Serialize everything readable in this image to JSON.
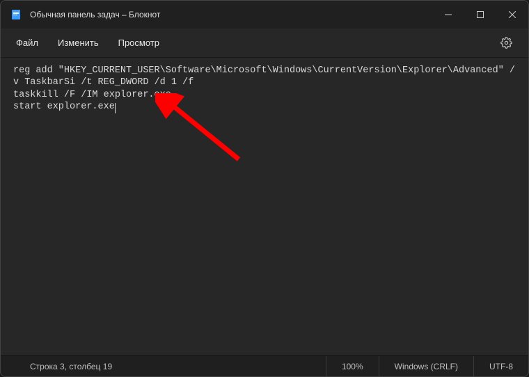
{
  "window": {
    "title": "Обычная панель задач – Блокнот"
  },
  "menu": {
    "file": "Файл",
    "edit": "Изменить",
    "view": "Просмотр"
  },
  "editor": {
    "lines": [
      "reg add \"HKEY_CURRENT_USER\\Software\\Microsoft\\Windows\\CurrentVersion\\Explorer\\Advanced\" /v TaskbarSi /t REG_DWORD /d 1 /f",
      "taskkill /F /IM explorer.exe",
      "start explorer.exe"
    ]
  },
  "status": {
    "position": "Строка 3, столбец 19",
    "zoom": "100%",
    "line_ending": "Windows (CRLF)",
    "encoding": "UTF-8"
  }
}
